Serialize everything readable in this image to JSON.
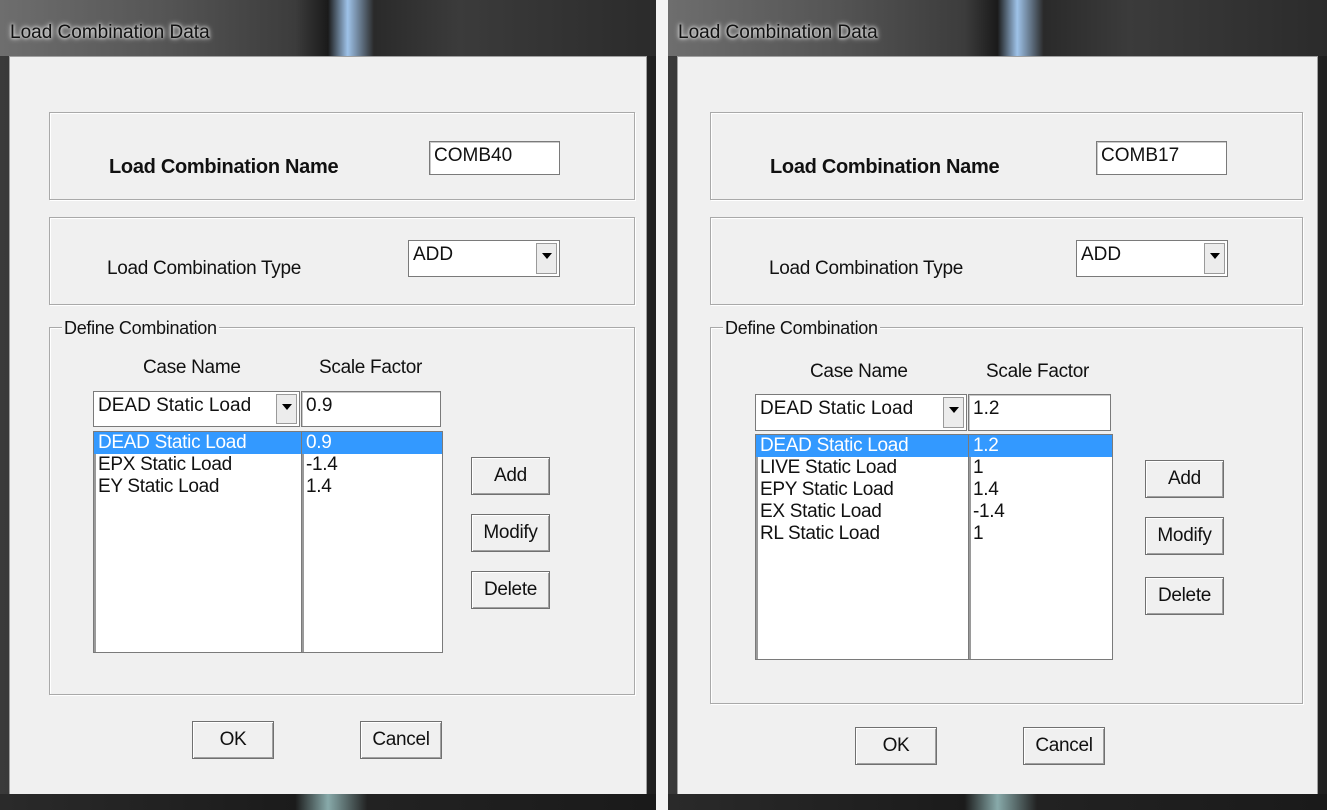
{
  "dialogs": [
    {
      "title": "Load Combination Data",
      "name_label": "Load Combination Name",
      "name_value": "COMB40",
      "type_label": "Load Combination Type",
      "type_value": "ADD",
      "group_label": "Define Combination",
      "case_header": "Case Name",
      "scale_header": "Scale Factor",
      "case_select": "DEAD Static Load",
      "scale_input": "0.9",
      "rows": [
        {
          "case": "DEAD Static Load",
          "scale": "0.9"
        },
        {
          "case": "EPX Static Load",
          "scale": "-1.4"
        },
        {
          "case": "EY Static Load",
          "scale": "1.4"
        }
      ],
      "add": "Add",
      "modify": "Modify",
      "delete": "Delete",
      "ok": "OK",
      "cancel": "Cancel"
    },
    {
      "title": "Load Combination Data",
      "name_label": "Load Combination Name",
      "name_value": "COMB17",
      "type_label": "Load Combination Type",
      "type_value": "ADD",
      "group_label": "Define Combination",
      "case_header": "Case Name",
      "scale_header": "Scale Factor",
      "case_select": "DEAD Static Load",
      "scale_input": "1.2",
      "rows": [
        {
          "case": "DEAD Static Load",
          "scale": "1.2"
        },
        {
          "case": "LIVE Static Load",
          "scale": "1"
        },
        {
          "case": "EPY Static Load",
          "scale": "1.4"
        },
        {
          "case": "EX Static Load",
          "scale": "-1.4"
        },
        {
          "case": "RL Static Load",
          "scale": "1"
        }
      ],
      "add": "Add",
      "modify": "Modify",
      "delete": "Delete",
      "ok": "OK",
      "cancel": "Cancel"
    }
  ],
  "icons": {
    "dropdown": "chevron-down-icon"
  },
  "colors": {
    "selection": "#3399ff",
    "dialog_bg": "#f0f0f0"
  }
}
